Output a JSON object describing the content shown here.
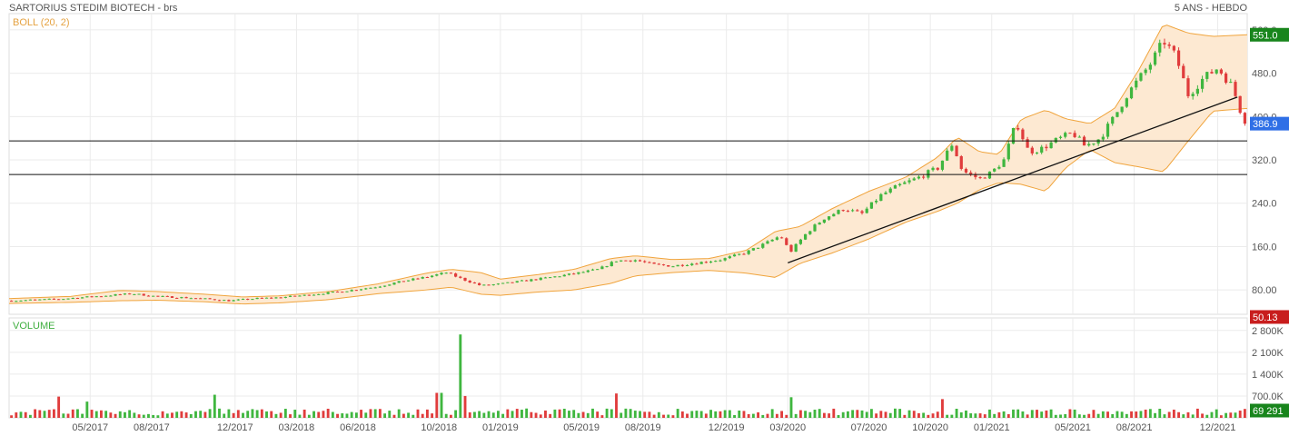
{
  "header": {
    "instrument": "SARTORIUS STEDIM BIOTECH - brs",
    "period": "5 ANS - HEBDO"
  },
  "indicator_label": "BOLL (20, 2)",
  "volume_label": "VOLUME",
  "badges": {
    "boll_upper": "551.0",
    "last_price": "386.9",
    "boll_lower": "50.13",
    "last_volume": "69 291"
  },
  "colors": {
    "up": "#3fb63f",
    "down": "#e03c3c",
    "band_fill": "#fde9d2",
    "band_line": "#f0a43c",
    "badge_green": "#18851c",
    "badge_blue": "#2f6fe6",
    "badge_red": "#c81d1d",
    "grid": "#ebebeb"
  },
  "chart_data": [
    {
      "type": "candlestick",
      "title": "SARTORIUS STEDIM BIOTECH - brs",
      "indicator": "BOLL (20, 2)",
      "ylim": [
        35,
        590
      ],
      "y_ticks": [
        "80.00",
        "160.0",
        "240.0",
        "320.0",
        "400.0",
        "480.0",
        "560.0"
      ],
      "x_ticks": [
        "05/2017",
        "08/2017",
        "12/2017",
        "03/2018",
        "06/2018",
        "10/2018",
        "01/2019",
        "05/2019",
        "08/2019",
        "12/2019",
        "03/2020",
        "07/2020",
        "10/2020",
        "01/2021",
        "05/2021",
        "08/2021",
        "12/2021"
      ],
      "x_tick_positions": [
        2017.33,
        2017.58,
        2017.92,
        2018.17,
        2018.42,
        2018.75,
        2019.0,
        2019.33,
        2019.58,
        2019.92,
        2020.17,
        2020.5,
        2020.75,
        2021.0,
        2021.33,
        2021.58,
        2021.92
      ],
      "x_range": [
        2017.0,
        2022.04
      ],
      "grid": true,
      "horizontal_lines": [
        355,
        293
      ],
      "trendline": [
        [
          2020.17,
          130
        ],
        [
          2022.0,
          436
        ]
      ],
      "close_path": [
        [
          2017.0,
          60
        ],
        [
          2017.2,
          63
        ],
        [
          2017.35,
          68
        ],
        [
          2017.5,
          73
        ],
        [
          2017.6,
          68
        ],
        [
          2017.75,
          65
        ],
        [
          2017.9,
          60
        ],
        [
          2018.0,
          64
        ],
        [
          2018.1,
          66
        ],
        [
          2018.2,
          70
        ],
        [
          2018.35,
          77
        ],
        [
          2018.5,
          86
        ],
        [
          2018.6,
          96
        ],
        [
          2018.7,
          104
        ],
        [
          2018.78,
          112
        ],
        [
          2018.85,
          99
        ],
        [
          2018.92,
          88
        ],
        [
          2019.0,
          91
        ],
        [
          2019.1,
          97
        ],
        [
          2019.2,
          103
        ],
        [
          2019.3,
          110
        ],
        [
          2019.4,
          118
        ],
        [
          2019.47,
          134
        ],
        [
          2019.55,
          135
        ],
        [
          2019.62,
          127
        ],
        [
          2019.7,
          124
        ],
        [
          2019.8,
          130
        ],
        [
          2019.9,
          136
        ],
        [
          2020.0,
          149
        ],
        [
          2020.08,
          166
        ],
        [
          2020.14,
          180
        ],
        [
          2020.18,
          150
        ],
        [
          2020.25,
          187
        ],
        [
          2020.32,
          213
        ],
        [
          2020.4,
          230
        ],
        [
          2020.47,
          220
        ],
        [
          2020.55,
          255
        ],
        [
          2020.62,
          272
        ],
        [
          2020.7,
          287
        ],
        [
          2020.78,
          305
        ],
        [
          2020.84,
          350
        ],
        [
          2020.88,
          300
        ],
        [
          2020.95,
          285
        ],
        [
          2021.0,
          297
        ],
        [
          2021.05,
          320
        ],
        [
          2021.1,
          390
        ],
        [
          2021.15,
          335
        ],
        [
          2021.2,
          340
        ],
        [
          2021.27,
          358
        ],
        [
          2021.33,
          370
        ],
        [
          2021.38,
          345
        ],
        [
          2021.44,
          360
        ],
        [
          2021.5,
          400
        ],
        [
          2021.55,
          440
        ],
        [
          2021.6,
          470
        ],
        [
          2021.65,
          500
        ],
        [
          2021.7,
          540
        ],
        [
          2021.75,
          510
        ],
        [
          2021.8,
          440
        ],
        [
          2021.86,
          470
        ],
        [
          2021.92,
          490
        ],
        [
          2021.98,
          455
        ],
        [
          2022.02,
          400
        ],
        [
          2022.04,
          387
        ]
      ],
      "boll_upper": [
        [
          2017.0,
          64
        ],
        [
          2017.25,
          68
        ],
        [
          2017.45,
          79
        ],
        [
          2017.6,
          77
        ],
        [
          2017.8,
          72
        ],
        [
          2017.95,
          67
        ],
        [
          2018.1,
          69
        ],
        [
          2018.3,
          77
        ],
        [
          2018.5,
          91
        ],
        [
          2018.7,
          111
        ],
        [
          2018.8,
          118
        ],
        [
          2018.92,
          112
        ],
        [
          2019.0,
          100
        ],
        [
          2019.15,
          108
        ],
        [
          2019.3,
          118
        ],
        [
          2019.45,
          138
        ],
        [
          2019.55,
          143
        ],
        [
          2019.7,
          136
        ],
        [
          2019.85,
          138
        ],
        [
          2020.0,
          153
        ],
        [
          2020.12,
          188
        ],
        [
          2020.22,
          197
        ],
        [
          2020.35,
          230
        ],
        [
          2020.5,
          262
        ],
        [
          2020.65,
          288
        ],
        [
          2020.78,
          325
        ],
        [
          2020.86,
          362
        ],
        [
          2020.95,
          335
        ],
        [
          2021.03,
          330
        ],
        [
          2021.12,
          395
        ],
        [
          2021.22,
          412
        ],
        [
          2021.3,
          396
        ],
        [
          2021.4,
          387
        ],
        [
          2021.5,
          415
        ],
        [
          2021.6,
          487
        ],
        [
          2021.7,
          571
        ],
        [
          2021.8,
          554
        ],
        [
          2021.9,
          548
        ],
        [
          2022.04,
          551
        ]
      ],
      "boll_lower": [
        [
          2017.0,
          55
        ],
        [
          2017.25,
          57
        ],
        [
          2017.45,
          60
        ],
        [
          2017.6,
          61
        ],
        [
          2017.8,
          58
        ],
        [
          2017.95,
          54
        ],
        [
          2018.1,
          56
        ],
        [
          2018.3,
          62
        ],
        [
          2018.5,
          73
        ],
        [
          2018.7,
          80
        ],
        [
          2018.8,
          85
        ],
        [
          2018.92,
          72
        ],
        [
          2019.0,
          70
        ],
        [
          2019.15,
          76
        ],
        [
          2019.3,
          80
        ],
        [
          2019.45,
          92
        ],
        [
          2019.55,
          106
        ],
        [
          2019.7,
          112
        ],
        [
          2019.85,
          116
        ],
        [
          2020.0,
          111
        ],
        [
          2020.12,
          103
        ],
        [
          2020.22,
          129
        ],
        [
          2020.35,
          148
        ],
        [
          2020.5,
          174
        ],
        [
          2020.65,
          205
        ],
        [
          2020.78,
          225
        ],
        [
          2020.86,
          240
        ],
        [
          2020.95,
          265
        ],
        [
          2021.03,
          278
        ],
        [
          2021.12,
          275
        ],
        [
          2021.22,
          262
        ],
        [
          2021.3,
          305
        ],
        [
          2021.4,
          339
        ],
        [
          2021.5,
          315
        ],
        [
          2021.6,
          307
        ],
        [
          2021.7,
          298
        ],
        [
          2021.8,
          355
        ],
        [
          2021.9,
          410
        ],
        [
          2022.04,
          415
        ]
      ]
    },
    {
      "type": "bar",
      "title": "VOLUME",
      "ylim": [
        0,
        3200
      ],
      "y_ticks": [
        "700.0K",
        "1 400K",
        "2 100K",
        "2 800K"
      ],
      "base_volume": 200,
      "spikes": [
        [
          2017.2,
          680
        ],
        [
          2017.32,
          520
        ],
        [
          2017.83,
          740
        ],
        [
          2018.75,
          800
        ],
        [
          2018.83,
          2670
        ],
        [
          2018.86,
          700
        ],
        [
          2019.47,
          780
        ],
        [
          2020.18,
          660
        ],
        [
          2020.8,
          600
        ]
      ],
      "last_volume": "69 291"
    }
  ]
}
